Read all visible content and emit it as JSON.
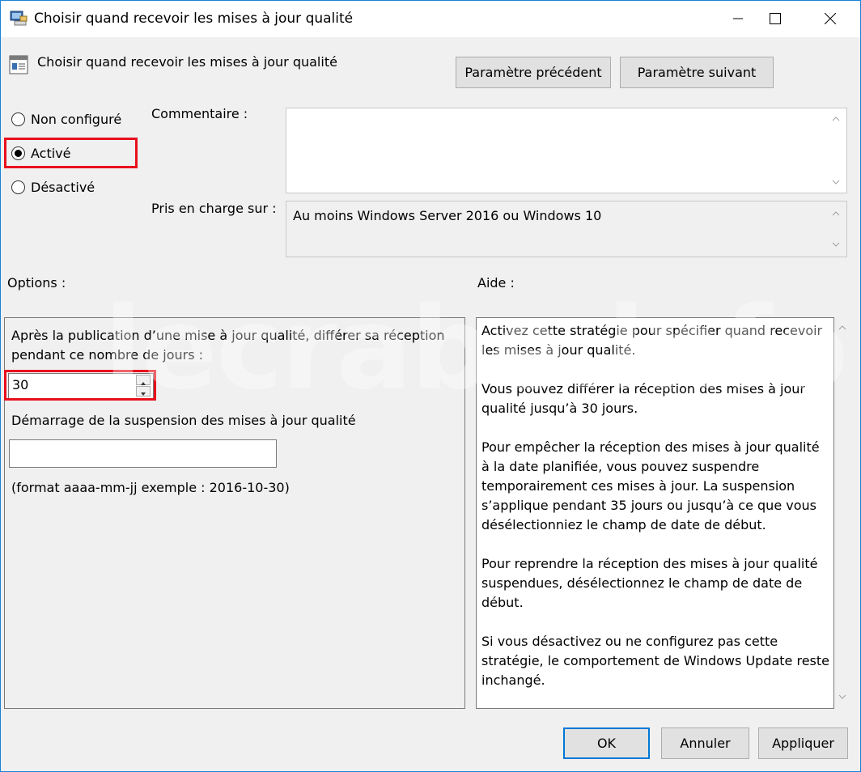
{
  "window": {
    "title": "Choisir quand recevoir les mises à jour qualité"
  },
  "header": {
    "policy_title": "Choisir quand recevoir les mises à jour qualité",
    "prev_button": "Paramètre précédent",
    "next_button": "Paramètre suivant"
  },
  "state": {
    "options": [
      {
        "label": "Non configuré",
        "selected": false
      },
      {
        "label": "Activé",
        "selected": true
      },
      {
        "label": "Désactivé",
        "selected": false
      }
    ]
  },
  "comment": {
    "label": "Commentaire :",
    "value": ""
  },
  "supported": {
    "label": "Pris en charge sur :",
    "value": "Au moins Windows Server 2016 ou Windows 10"
  },
  "options_section": {
    "label": "Options :",
    "defer_text": "Après la publication d’une mise à jour qualité, différer sa réception pendant ce nombre de jours :",
    "defer_value": "30",
    "pause_label": "Démarrage de la suspension des mises à jour qualité",
    "pause_value": "",
    "format_hint": "(format aaaa-mm-jj exemple : 2016-10-30)"
  },
  "help_section": {
    "label": "Aide :",
    "paragraphs": [
      "Activez cette stratégie pour spécifier quand recevoir les mises à jour qualité.",
      "Vous pouvez différer la réception des mises à jour qualité jusqu’à 30 jours.",
      "Pour empêcher la réception des mises à jour qualité à la date planifiée, vous pouvez suspendre temporairement ces mises à jour. La suspension s’applique pendant 35 jours ou jusqu’à ce que vous désélectionniez le champ de date de début.",
      "Pour reprendre la réception des mises à jour qualité suspendues, désélectionnez le champ de date de début.",
      "Si vous désactivez ou ne configurez pas cette stratégie, le comportement de Windows Update reste inchangé."
    ]
  },
  "footer": {
    "ok": "OK",
    "cancel": "Annuler",
    "apply": "Appliquer"
  },
  "watermark": "lecrabe.info",
  "colors": {
    "highlight": "#e8101c",
    "accent": "#0078d7"
  }
}
